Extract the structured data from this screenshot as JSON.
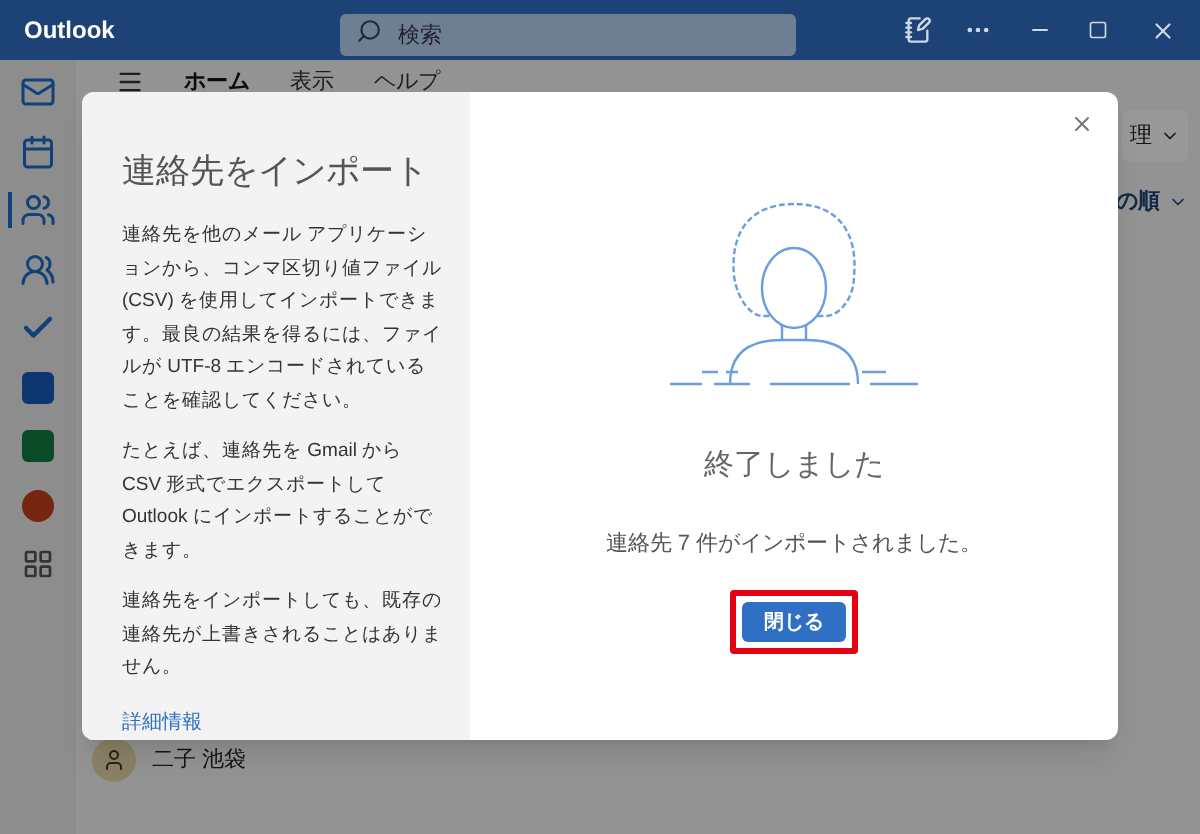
{
  "window": {
    "title": "Outlook"
  },
  "search": {
    "placeholder": "検索"
  },
  "rail": [
    {
      "kind": "mail",
      "selected": false
    },
    {
      "kind": "calendar",
      "selected": false
    },
    {
      "kind": "people",
      "selected": true
    },
    {
      "kind": "groups",
      "selected": false
    },
    {
      "kind": "todo",
      "selected": false
    },
    {
      "kind": "word",
      "selected": false
    },
    {
      "kind": "excel",
      "selected": false
    },
    {
      "kind": "powerpoint",
      "selected": false
    },
    {
      "kind": "apps",
      "selected": false
    }
  ],
  "ribbon_tabs": [
    {
      "label": "ホーム",
      "selected": true
    },
    {
      "label": "表示",
      "selected": false
    },
    {
      "label": "ヘルプ",
      "selected": false
    }
  ],
  "ribbon_button": "理",
  "sort": "の順",
  "contact": {
    "name": "二子 池袋"
  },
  "dialog": {
    "title": "連絡先をインポート",
    "paragraphs": [
      "連絡先を他のメール アプリケーションから、コンマ区切り値ファイル (CSV) を使用してインポートできます。最良の結果を得るには、ファイルが UTF-8 エンコードされていることを確認してください。",
      "たとえば、連絡先を Gmail から CSV 形式でエクスポートして Outlook にインポートすることができます。",
      "連絡先をインポートしても、既存の連絡先が上書きされることはありません。"
    ],
    "link": "詳細情報",
    "status_title": "終了しました",
    "message": "連絡先 7 件がインポートされました。",
    "button": "閉じる",
    "highlighted": true
  }
}
